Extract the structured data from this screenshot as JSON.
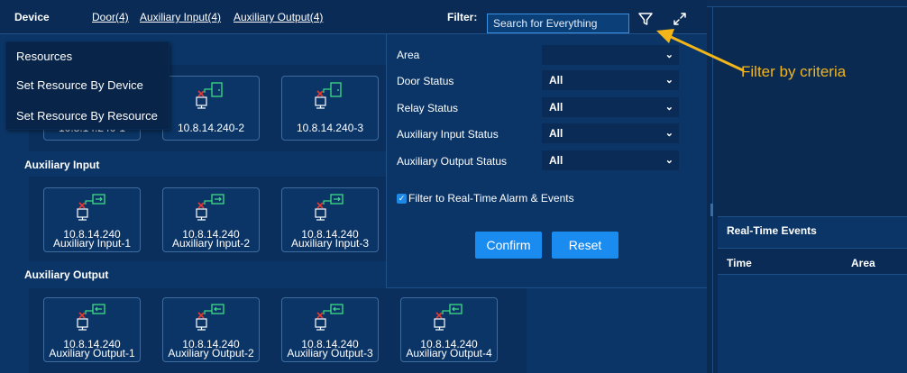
{
  "topbar": {
    "device": "Device",
    "door": "Door(4)",
    "aux_input": "Auxiliary Input(4)",
    "aux_output": "Auxiliary Output(4)",
    "filter_label": "Filter:",
    "search_placeholder": "Search for Everything",
    "icons": [
      "filter-funnel-icon",
      "collapse-arrows-icon"
    ]
  },
  "menu": [
    "Resources",
    "Set Resource By Device",
    "Set Resource By Resource"
  ],
  "door_cards": [
    "10.8.14.240-1",
    "10.8.14.240-2",
    "10.8.14.240-3"
  ],
  "aux_input": {
    "title": "Auxiliary Input",
    "cards": [
      {
        "ip": "10.8.14.240",
        "name": "Auxiliary Input-1"
      },
      {
        "ip": "10.8.14.240",
        "name": "Auxiliary Input-2"
      },
      {
        "ip": "10.8.14.240",
        "name": "Auxiliary Input-3"
      }
    ]
  },
  "aux_output": {
    "title": "Auxiliary Output",
    "cards": [
      {
        "ip": "10.8.14.240",
        "name": "Auxiliary Output-1"
      },
      {
        "ip": "10.8.14.240",
        "name": "Auxiliary Output-2"
      },
      {
        "ip": "10.8.14.240",
        "name": "Auxiliary Output-3"
      },
      {
        "ip": "10.8.14.240",
        "name": "Auxiliary Output-4"
      }
    ]
  },
  "filter": {
    "area_label": "Area",
    "area_value": "",
    "door_status_label": "Door Status",
    "door_status_value": "All",
    "relay_status_label": "Relay Status",
    "relay_status_value": "All",
    "aux_in_status_label": "Auxiliary Input Status",
    "aux_in_status_value": "All",
    "aux_out_status_label": "Auxiliary Output Status",
    "aux_out_status_value": "All",
    "realtime_checkbox": "Filter to Real-Time Alarm & Events",
    "realtime_checked": true,
    "confirm": "Confirm",
    "reset": "Reset"
  },
  "events": {
    "title": "Real-Time Events",
    "col_time": "Time",
    "col_area": "Area"
  },
  "annotation": "Filter by criteria",
  "colors": {
    "accent": "#1a8cf0",
    "annotation": "#f2b51a",
    "background": "#0b3566",
    "alarm_x": "#e53935",
    "device_green": "#3ddc84"
  }
}
